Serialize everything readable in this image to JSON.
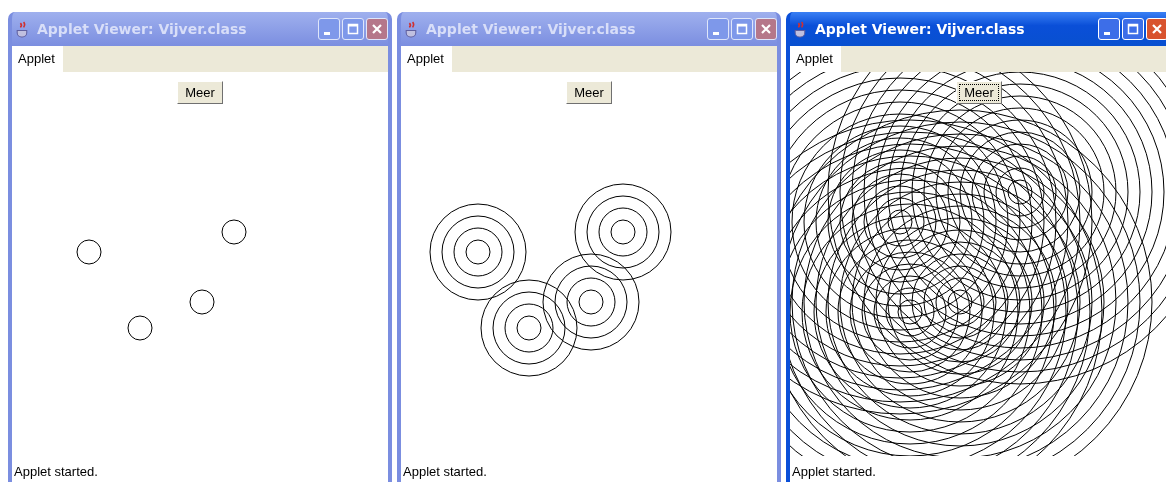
{
  "windows": [
    {
      "title": "Applet Viewer: Vijver.class",
      "active": false,
      "menu": "Applet",
      "button": "Meer",
      "button_focused": false,
      "status": "Applet started."
    },
    {
      "title": "Applet Viewer: Vijver.class",
      "active": false,
      "menu": "Applet",
      "button": "Meer",
      "button_focused": false,
      "status": "Applet started."
    },
    {
      "title": "Applet Viewer: Vijver.class",
      "active": true,
      "menu": "Applet",
      "button": "Meer",
      "button_focused": true,
      "status": "Applet started."
    }
  ]
}
